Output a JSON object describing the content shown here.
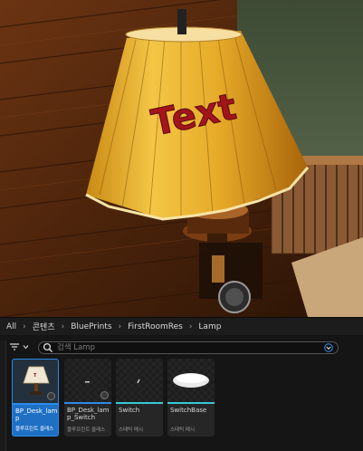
{
  "viewport": {
    "overlay_text": "Text"
  },
  "breadcrumb": {
    "items": [
      "All",
      "콘텐츠",
      "BluePrints",
      "FirstRoomRes",
      "Lamp"
    ]
  },
  "search": {
    "placeholder": "검색 Lamp"
  },
  "assets": [
    {
      "name": "BP_Desk_lamp",
      "type": "블루프린트 클래스",
      "selected": true,
      "type_color": "#2d8ae8",
      "icon": "lamp-thumbnail-icon"
    },
    {
      "name": "BP_Desk_lamp_Switch",
      "type": "블루프린트 클래스",
      "selected": false,
      "type_color": "#2d8ae8",
      "icon": "switch-thumbnail-icon"
    },
    {
      "name": "Switch",
      "type": "스태틱 메시",
      "selected": false,
      "type_color": "#35c9d8",
      "icon": "switch-mesh-icon"
    },
    {
      "name": "SwitchBase",
      "type": "스태틱 메시",
      "selected": false,
      "type_color": "#35c9d8",
      "icon": "switch-base-mesh-icon"
    }
  ]
}
